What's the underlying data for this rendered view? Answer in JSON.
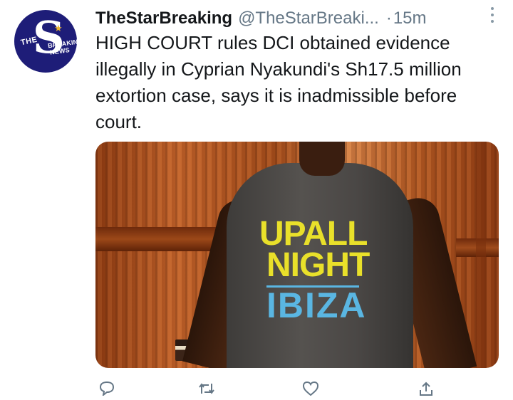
{
  "tweet": {
    "author_name": "TheStarBreaking",
    "handle": "@TheStarBreaki...",
    "separator": "·",
    "time": "15m",
    "text": "HIGH COURT rules DCI obtained evidence illegally in Cyprian Nyakundi's Sh17.5 million extortion case, says it is inadmissible before court."
  },
  "avatar": {
    "prefix": "THE",
    "letter": "S",
    "line1": "BREAKING",
    "line2": "NEWS",
    "bg_color": "#1e1d78",
    "accent_color": "#e8b230"
  },
  "media": {
    "shirt_line1": "UPALL",
    "shirt_line2": "NIGHT",
    "shirt_line3": "IBIZA"
  },
  "actions": {
    "reply_icon": "reply-icon",
    "retweet_icon": "retweet-icon",
    "like_icon": "heart-icon",
    "share_icon": "share-icon"
  },
  "colors": {
    "text": "#14171a",
    "secondary": "#657786"
  }
}
